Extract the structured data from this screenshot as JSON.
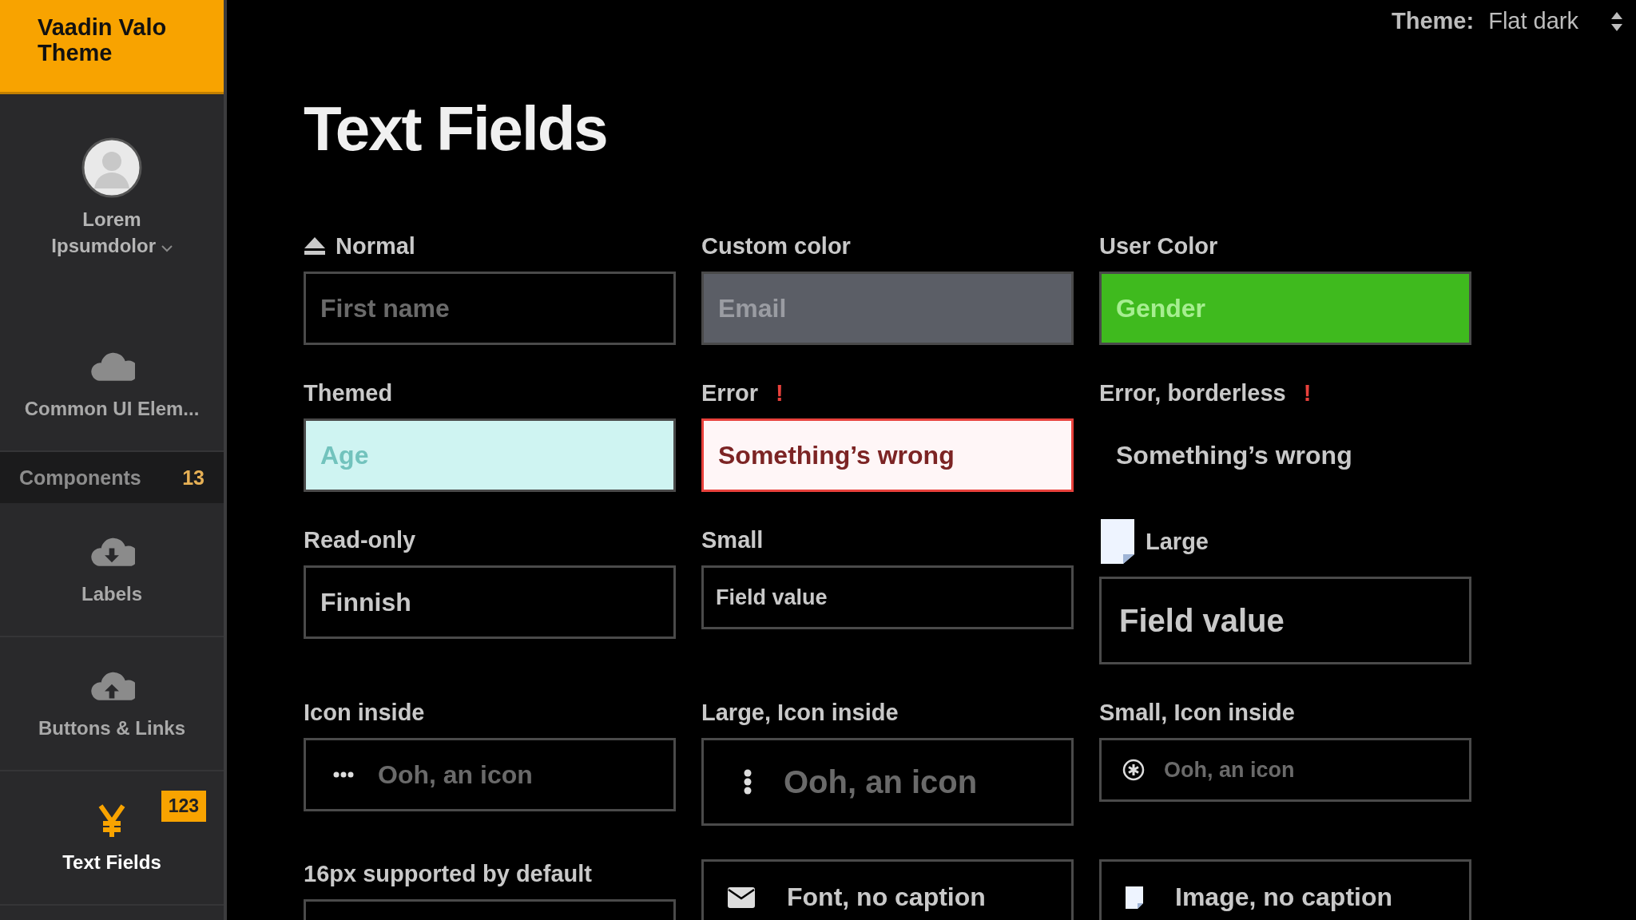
{
  "sidebar": {
    "title": "Vaadin Valo Theme",
    "user": {
      "first_name": "Lorem",
      "last_name": "Ipsumdolor"
    },
    "items": [
      {
        "kind": "item",
        "label": "Common UI Elem...",
        "selected": false
      },
      {
        "kind": "section",
        "label": "Components",
        "count": "13"
      },
      {
        "kind": "item",
        "label": "Labels",
        "selected": false
      },
      {
        "kind": "item",
        "label": "Buttons & Links",
        "selected": false
      },
      {
        "kind": "item",
        "label": "Text Fields",
        "badge": "123",
        "selected": true
      }
    ]
  },
  "theme": {
    "label": "Theme:",
    "value": "Flat dark"
  },
  "page_title": "Text Fields",
  "fields": [
    {
      "caption": "Normal",
      "kind": "normal",
      "placeholder": "First name"
    },
    {
      "caption": "Custom color",
      "kind": "custom",
      "placeholder": "Email"
    },
    {
      "caption": "User Color",
      "kind": "user",
      "placeholder": "Gender"
    },
    {
      "caption": "Themed",
      "kind": "themed",
      "placeholder": "Age"
    },
    {
      "caption": "Error",
      "kind": "error",
      "error": true,
      "error_mark": "!",
      "value": "Something’s wrong"
    },
    {
      "caption": "Error, borderless",
      "kind": "borderless",
      "error": true,
      "error_mark": "!",
      "value": "Something’s wrong"
    },
    {
      "caption": "Read-only",
      "kind": "readonly",
      "value": "Finnish"
    },
    {
      "caption": "Small",
      "kind": "small",
      "value": "Field value"
    },
    {
      "caption": "Large",
      "kind": "large",
      "value": "Field value"
    },
    {
      "caption": "Icon inside",
      "kind": "icon",
      "placeholder": "Ooh, an icon"
    },
    {
      "caption": "Large, Icon inside",
      "kind": "icon-large",
      "placeholder": "Ooh, an icon"
    },
    {
      "caption": "Small, Icon inside",
      "kind": "icon-small",
      "placeholder": "Ooh, an icon"
    },
    {
      "caption": "16px supported by default",
      "kind": "cut"
    },
    {
      "kind": "font-icon",
      "value": "Font, no caption"
    },
    {
      "kind": "image-icon",
      "value": "Image, no caption"
    }
  ]
}
